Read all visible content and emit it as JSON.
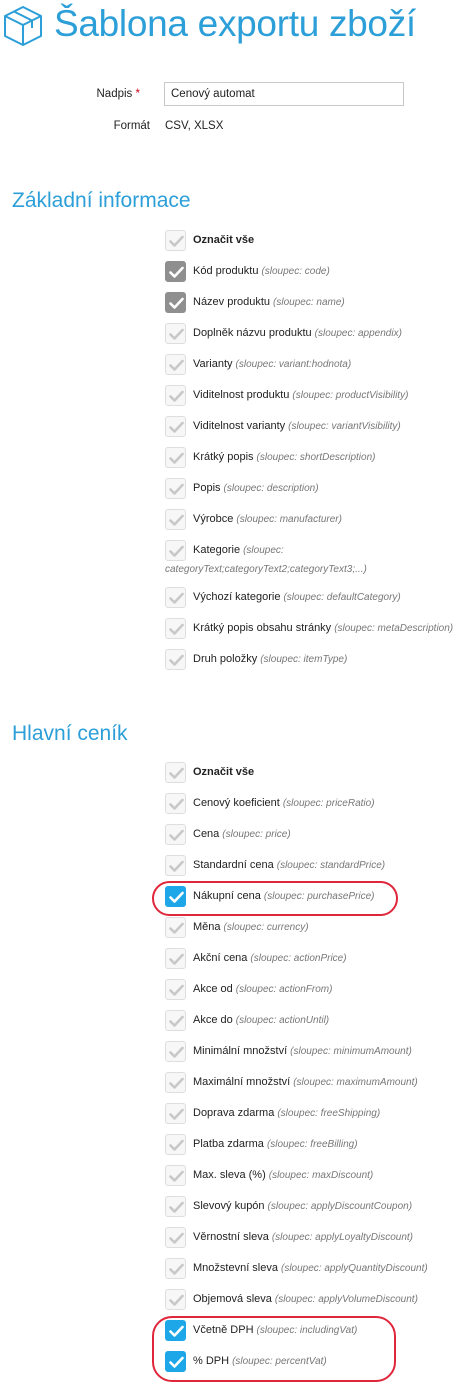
{
  "header": {
    "title": "Šablona exportu zboží",
    "icon": "box-icon"
  },
  "form": {
    "title_label": "Nadpis",
    "required_mark": "*",
    "title_value": "Cenový automat",
    "format_label": "Formát",
    "format_value": "CSV, XLSX"
  },
  "sections": [
    {
      "title": "Základní informace",
      "items": [
        {
          "label": "Označit vše",
          "column": "",
          "bold": true,
          "state": "unchecked"
        },
        {
          "label": "Kód produktu",
          "column": "(sloupec: code)",
          "state": "grey"
        },
        {
          "label": "Název produktu",
          "column": "(sloupec: name)",
          "state": "grey"
        },
        {
          "label": "Doplněk názvu produktu",
          "column": "(sloupec: appendix)",
          "state": "unchecked"
        },
        {
          "label": "Varianty",
          "column": "(sloupec: variant:hodnota)",
          "state": "unchecked"
        },
        {
          "label": "Viditelnost produktu",
          "column": "(sloupec: productVisibility)",
          "state": "unchecked"
        },
        {
          "label": "Viditelnost varianty",
          "column": "(sloupec: variantVisibility)",
          "state": "unchecked"
        },
        {
          "label": "Krátký popis",
          "column": "(sloupec: shortDescription)",
          "state": "unchecked"
        },
        {
          "label": "Popis",
          "column": "(sloupec: description)",
          "state": "unchecked"
        },
        {
          "label": "Výrobce",
          "column": "(sloupec: manufacturer)",
          "state": "unchecked"
        },
        {
          "label": "Kategorie",
          "column": "(sloupec:",
          "column_cont": "categoryText;categoryText2;categoryText3;...)",
          "state": "unchecked"
        },
        {
          "label": "Výchozí kategorie",
          "column": "(sloupec: defaultCategory)",
          "state": "unchecked"
        },
        {
          "label": "Krátký popis obsahu stránky",
          "column": "(sloupec: metaDescription)",
          "state": "unchecked"
        },
        {
          "label": "Druh položky",
          "column": "(sloupec: itemType)",
          "state": "unchecked"
        }
      ]
    },
    {
      "title": "Hlavní ceník",
      "items": [
        {
          "label": "Označit vše",
          "column": "",
          "bold": true,
          "state": "unchecked"
        },
        {
          "label": "Cenový koeficient",
          "column": "(sloupec: priceRatio)",
          "state": "unchecked"
        },
        {
          "label": "Cena",
          "column": "(sloupec: price)",
          "state": "unchecked"
        },
        {
          "label": "Standardní cena",
          "column": "(sloupec: standardPrice)",
          "state": "unchecked"
        },
        {
          "label": "Nákupní cena",
          "column": "(sloupec: purchasePrice)",
          "state": "blue"
        },
        {
          "label": "Měna",
          "column": "(sloupec: currency)",
          "state": "unchecked"
        },
        {
          "label": "Akční cena",
          "column": "(sloupec: actionPrice)",
          "state": "unchecked"
        },
        {
          "label": "Akce od",
          "column": "(sloupec: actionFrom)",
          "state": "unchecked"
        },
        {
          "label": "Akce do",
          "column": "(sloupec: actionUntil)",
          "state": "unchecked"
        },
        {
          "label": "Minimální množství",
          "column": "(sloupec: minimumAmount)",
          "state": "unchecked"
        },
        {
          "label": "Maximální množství",
          "column": "(sloupec: maximumAmount)",
          "state": "unchecked"
        },
        {
          "label": "Doprava zdarma",
          "column": "(sloupec: freeShipping)",
          "state": "unchecked"
        },
        {
          "label": "Platba zdarma",
          "column": "(sloupec: freeBilling)",
          "state": "unchecked"
        },
        {
          "label": "Max. sleva (%)",
          "column": "(sloupec: maxDiscount)",
          "state": "unchecked"
        },
        {
          "label": "Slevový kupón",
          "column": "(sloupec: applyDiscountCoupon)",
          "state": "unchecked"
        },
        {
          "label": "Věrnostní sleva",
          "column": "(sloupec: applyLoyaltyDiscount)",
          "state": "unchecked"
        },
        {
          "label": "Množstevní sleva",
          "column": "(sloupec: applyQuantityDiscount)",
          "state": "unchecked"
        },
        {
          "label": "Objemová sleva",
          "column": "(sloupec: applyVolumeDiscount)",
          "state": "unchecked"
        },
        {
          "label": "Včetně DPH",
          "column": "(sloupec: includingVat)",
          "state": "blue"
        },
        {
          "label": "% DPH",
          "column": "(sloupec: percentVat)",
          "state": "blue"
        }
      ]
    }
  ],
  "colors": {
    "accent": "#2c9fd8",
    "checked": "#1ea7e8",
    "disabled_checked": "#8f8f8f",
    "highlight": "#e0263a"
  }
}
